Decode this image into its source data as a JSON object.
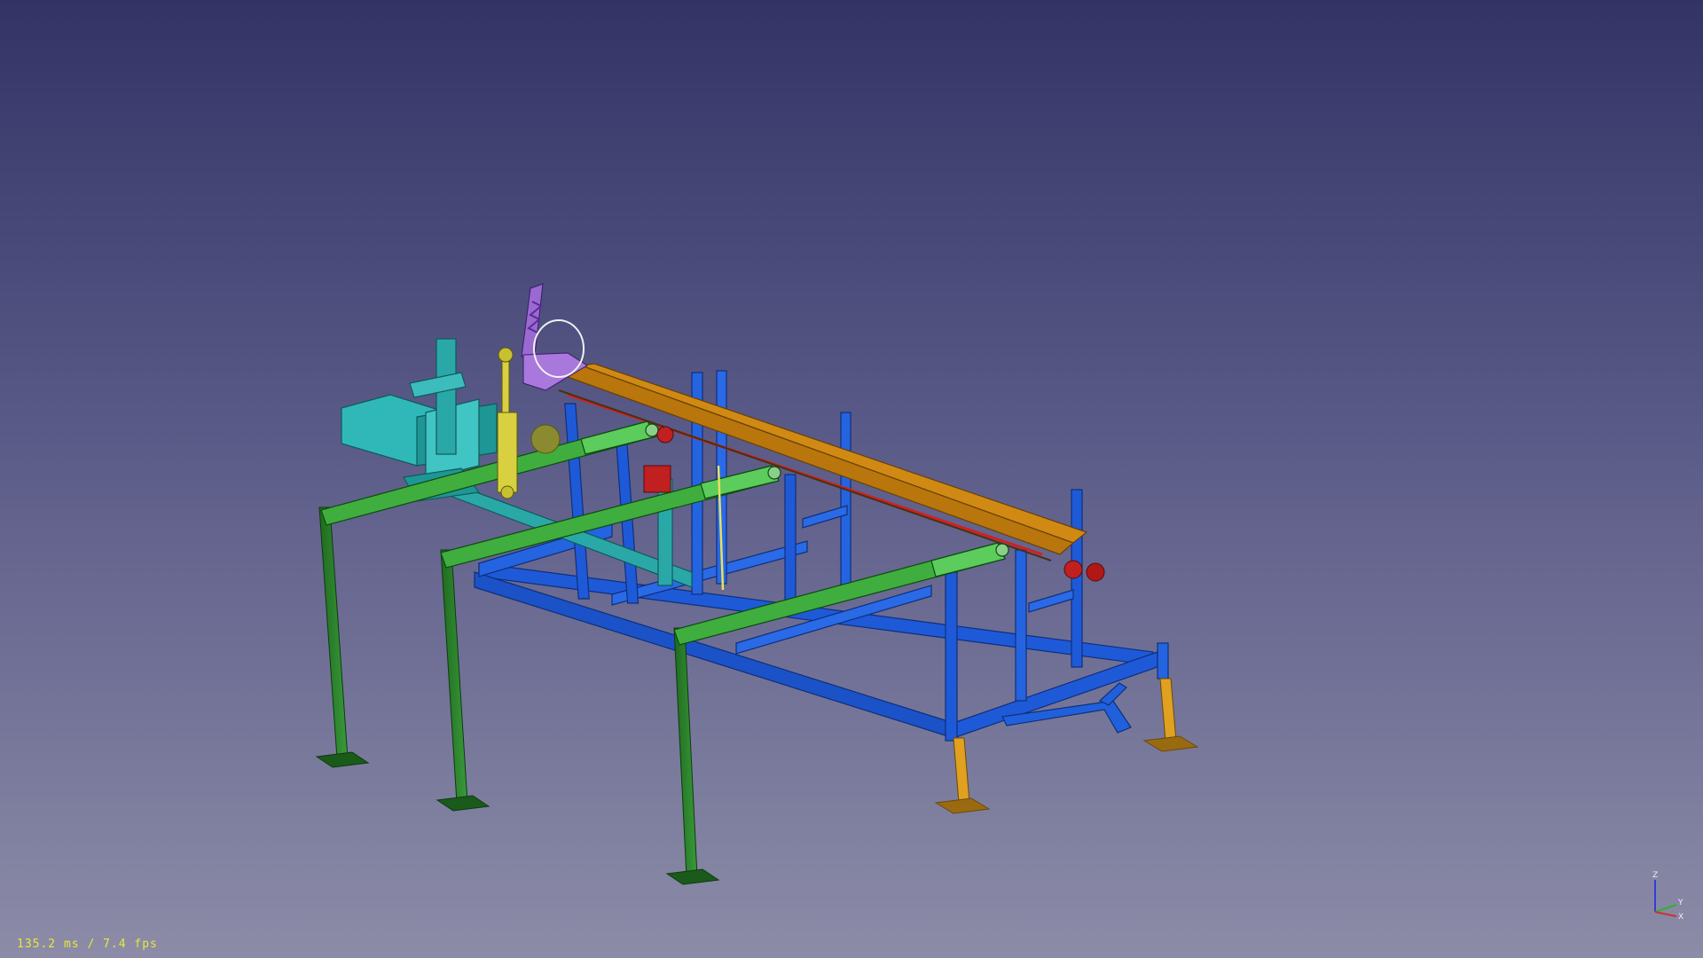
{
  "viewer": {
    "background_top": "#333366",
    "background_bottom": "#8c8ca8",
    "fps_text": "135.2 ms / 7.4 fps"
  },
  "axes": {
    "x_label": "X",
    "y_label": "Y",
    "z_label": "Z",
    "x_color": "#d03030",
    "y_color": "#30b030",
    "z_color": "#3040d0"
  },
  "model_colors": {
    "frame_blue": "#1e5ad8",
    "legs_green": "#2e8a2e",
    "arms_green": "#3fae3f",
    "rail_orange": "#d08a14",
    "leg_orange": "#e0a020",
    "hopper_cyan": "#2aa8a8",
    "claw_purple": "#9a6ad0",
    "cylinder_yellow": "#d8d040",
    "sprocket_red": "#c02020"
  }
}
